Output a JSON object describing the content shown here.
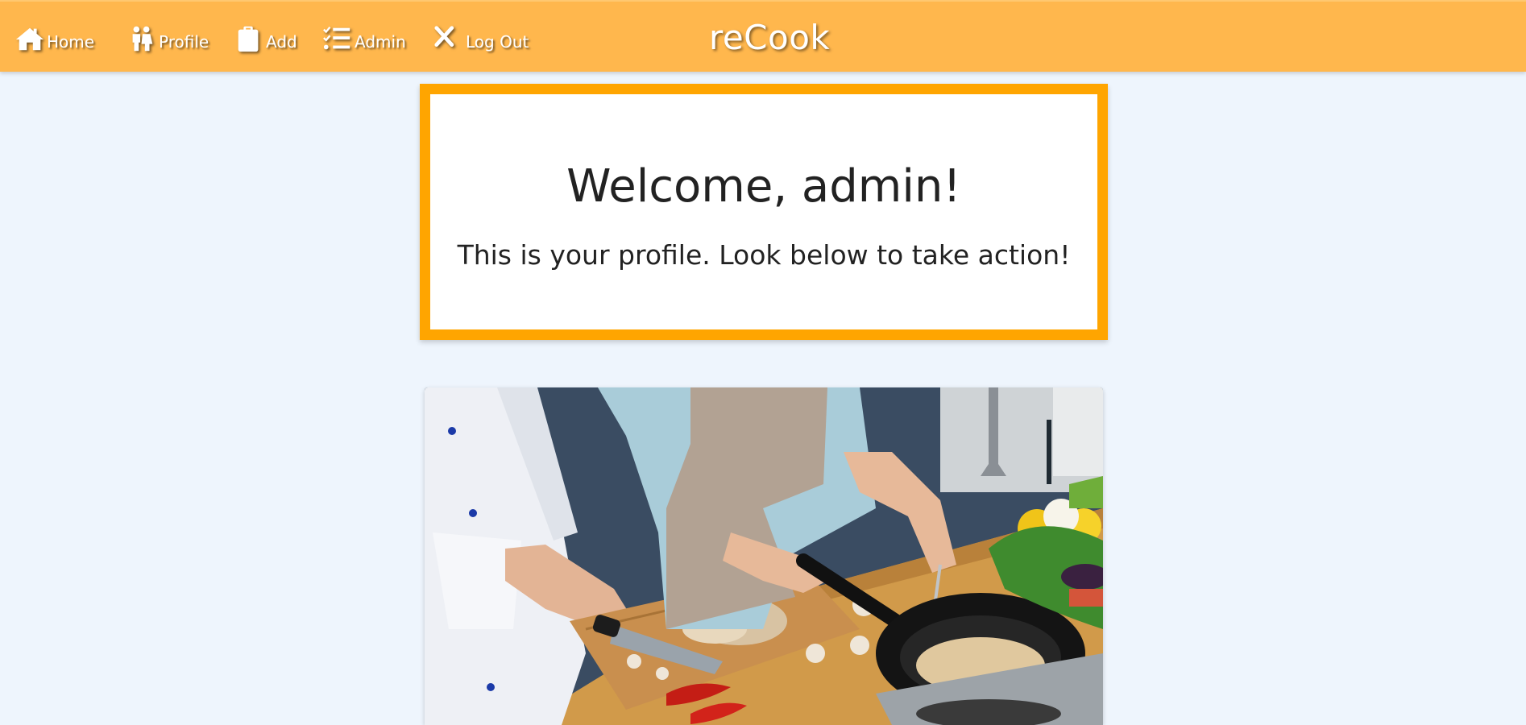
{
  "nav": {
    "items": [
      {
        "label": "Home",
        "icon": "home-icon"
      },
      {
        "label": "Profile",
        "icon": "people-icon"
      },
      {
        "label": "Add",
        "icon": "clipboard-icon"
      },
      {
        "label": "Admin",
        "icon": "checklist-icon"
      },
      {
        "label": "Log Out",
        "icon": "close-icon"
      }
    ],
    "brand": "reCook"
  },
  "welcome": {
    "title": "Welcome, admin!",
    "subtitle": "This is your profile. Look below to take action!"
  },
  "colors": {
    "navbar": "#ffb74d",
    "card_border": "#ffa500",
    "page_background": "#eef5fd"
  },
  "photo": {
    "subject": "cooking-photo"
  }
}
